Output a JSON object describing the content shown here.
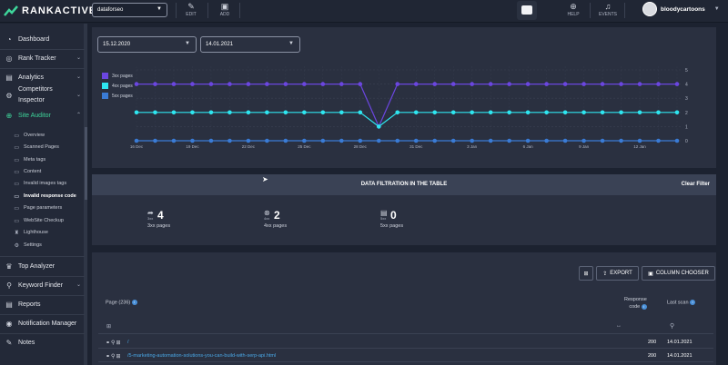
{
  "app": {
    "logo_text": "RANKACTIVE",
    "project": "dataforseo",
    "actions": [
      {
        "label": "EDIT",
        "icon": "pencil-icon"
      },
      {
        "label": "ADD",
        "icon": "save-icon"
      }
    ],
    "right_actions": [
      {
        "label": "HELP",
        "icon": "lifebuoy-icon"
      },
      {
        "label": "EVENTS",
        "icon": "bell-icon"
      }
    ],
    "username": "bloodycartoons"
  },
  "sidebar": {
    "items": [
      {
        "label": "Dashboard",
        "icon": "dashboard-icon"
      },
      {
        "label": "Rank Tracker",
        "icon": "target-icon"
      },
      {
        "label": "Analytics",
        "icon": "analytics-icon"
      },
      {
        "label": "Competitors Inspector",
        "label_line1": "Competitors",
        "label_line2": "Inspector",
        "icon": "competitors-icon"
      },
      {
        "label": "Site Auditor",
        "icon": "auditor-icon"
      }
    ],
    "sub_items": [
      {
        "label": "Overview",
        "icon": "overview-icon"
      },
      {
        "label": "Scanned Pages",
        "icon": "pages-icon"
      },
      {
        "label": "Meta tags",
        "icon": "tag-icon"
      },
      {
        "label": "Content",
        "icon": "content-icon"
      },
      {
        "label": "Invalid images tags",
        "icon": "image-icon"
      },
      {
        "label": "Invalid response code",
        "icon": "response-icon"
      },
      {
        "label": "Page parameters",
        "icon": "params-icon"
      },
      {
        "label": "WebSite Checkup",
        "icon": "checkup-icon"
      },
      {
        "label": "Lighthouse",
        "icon": "lighthouse-icon"
      },
      {
        "label": "Settings",
        "icon": "gear-icon"
      }
    ],
    "bottom_items": [
      {
        "label": "Top Analyzer",
        "icon": "top-analyzer-icon"
      },
      {
        "label": "Keyword Finder",
        "icon": "keyword-icon"
      },
      {
        "label": "Reports",
        "icon": "reports-icon"
      },
      {
        "label": "Notification Manager",
        "icon": "notification-icon"
      },
      {
        "label": "Notes",
        "icon": "notes-icon"
      }
    ]
  },
  "dates": {
    "from": "15.12.2020",
    "to": "14.01.2021"
  },
  "chart_data": {
    "type": "line",
    "x": [
      "16 Dec",
      "17 Dec",
      "18 Dec",
      "19 Dec",
      "20 Dec",
      "21 Dec",
      "22 Dec",
      "23 Dec",
      "24 Dec",
      "25 Dec",
      "26 Dec",
      "27 Dec",
      "28 Dec",
      "29 Dec",
      "30 Dec",
      "31 Dec",
      "1 Jan",
      "2 Jan",
      "3 Jan",
      "4 Jan",
      "5 Jan",
      "6 Jan",
      "7 Jan",
      "8 Jan",
      "9 Jan",
      "10 Jan",
      "11 Jan",
      "12 Jan",
      "13 Jan",
      "14 Jan"
    ],
    "x_tick_labels": [
      "16 Dec",
      "19 Dec",
      "22 Dec",
      "25 Dec",
      "28 Dec",
      "31 Dec",
      "3 Jan",
      "6 Jan",
      "9 Jan",
      "12 Jan"
    ],
    "ylim": [
      0,
      5
    ],
    "y_ticks": [
      0,
      1,
      2,
      3,
      4,
      5
    ],
    "series": [
      {
        "name": "3xx pages",
        "color": "#6b46e0",
        "values": [
          4,
          4,
          4,
          4,
          4,
          4,
          4,
          4,
          4,
          4,
          4,
          4,
          4,
          1,
          4,
          4,
          4,
          4,
          4,
          4,
          4,
          4,
          4,
          4,
          4,
          4,
          4,
          4,
          4,
          4
        ]
      },
      {
        "name": "4xx pages",
        "color": "#2ee6f0",
        "values": [
          2,
          2,
          2,
          2,
          2,
          2,
          2,
          2,
          2,
          2,
          2,
          2,
          2,
          1,
          2,
          2,
          2,
          2,
          2,
          2,
          2,
          2,
          2,
          2,
          2,
          2,
          2,
          2,
          2,
          2
        ]
      },
      {
        "name": "5xx pages",
        "color": "#3a7bd5",
        "values": [
          0,
          0,
          0,
          0,
          0,
          0,
          0,
          0,
          0,
          0,
          0,
          0,
          0,
          0,
          0,
          0,
          0,
          0,
          0,
          0,
          0,
          0,
          0,
          0,
          0,
          0,
          0,
          0,
          0,
          0
        ]
      }
    ],
    "grid": true,
    "legend": "top-left"
  },
  "filtration": {
    "title": "DATA FILTRATION IN THE TABLE",
    "clear": "Clear Filter",
    "stats": [
      {
        "tag": "3xx",
        "value": "4",
        "label": "3xx pages",
        "icon": "redirect-icon"
      },
      {
        "tag": "4xx",
        "value": "2",
        "label": "4xx pages",
        "icon": "error-icon"
      },
      {
        "tag": "5xx",
        "value": "0",
        "label": "5xx pages",
        "icon": "server-icon"
      }
    ]
  },
  "table": {
    "export_label": "EXPORT",
    "column_chooser_label": "COLUMN CHOOSER",
    "col_page": "Page (236)",
    "col_response": "Response",
    "col_response_2": "code",
    "col_scan": "Last scan",
    "rows": [
      {
        "url": "/",
        "code": "200",
        "scan": "14.01.2021"
      },
      {
        "url": "/5-marketing-automation-solutions-you-can-build-with-serp-api.html",
        "code": "200",
        "scan": "14.01.2021"
      }
    ]
  }
}
